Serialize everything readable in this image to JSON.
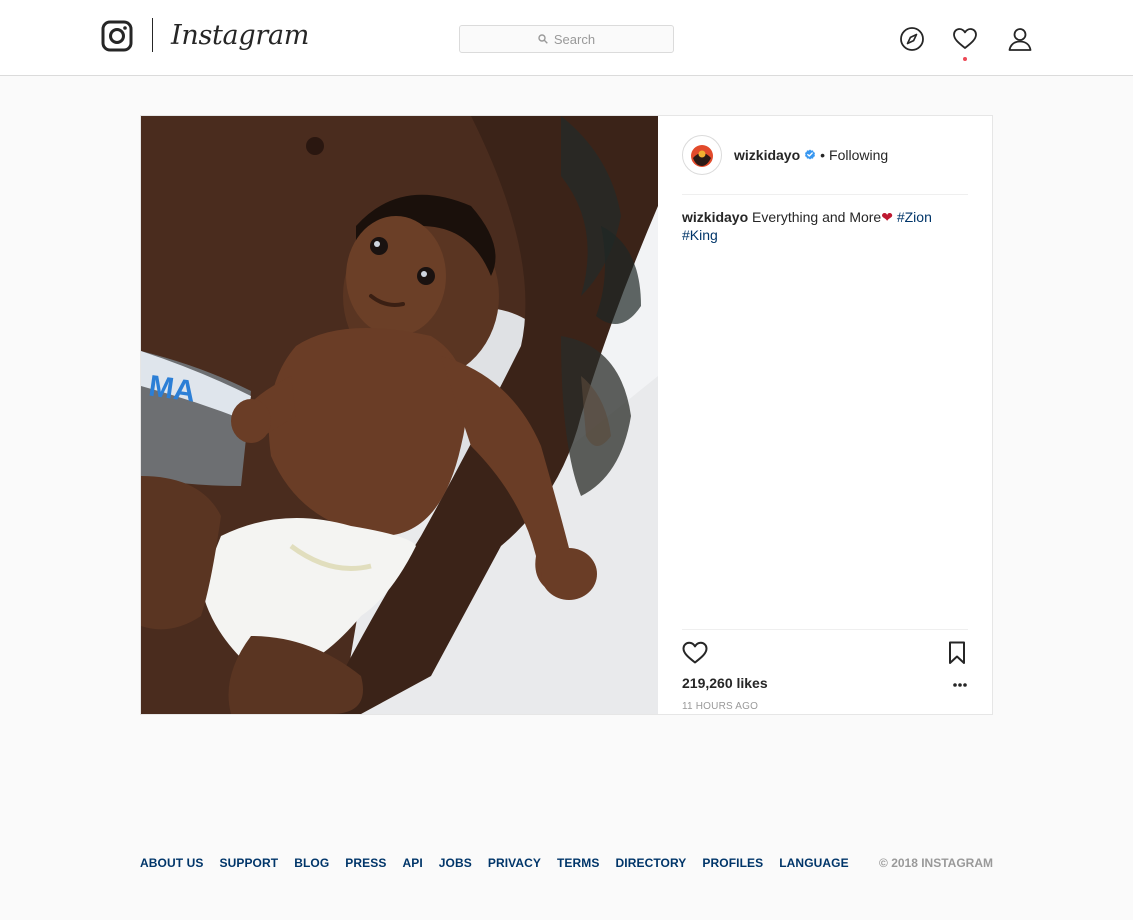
{
  "header": {
    "wordmark": "Instagram",
    "search_placeholder": "Search",
    "icons": [
      "explore-compass-icon",
      "activity-heart-icon",
      "profile-user-icon"
    ],
    "has_notification_dot": true,
    "colors": {
      "notification": "#ed4956"
    }
  },
  "post": {
    "username": "wizkidayo",
    "verified": true,
    "follow_status": "Following",
    "separator": "•",
    "caption": {
      "user": "wizkidayo",
      "text": "Everything and More",
      "emoji": "❤",
      "hashtags": [
        "#Zion",
        "#King"
      ]
    },
    "likes": "219,260 likes",
    "time_ago": "11 hours ago"
  },
  "footer": {
    "links": [
      "ABOUT US",
      "SUPPORT",
      "BLOG",
      "PRESS",
      "API",
      "JOBS",
      "PRIVACY",
      "TERMS",
      "DIRECTORY",
      "PROFILES",
      "LANGUAGE"
    ],
    "copyright": "© 2018 INSTAGRAM"
  },
  "colors": {
    "link": "#003569",
    "verified": "#3897f0",
    "muted": "#999999",
    "text": "#262626"
  }
}
